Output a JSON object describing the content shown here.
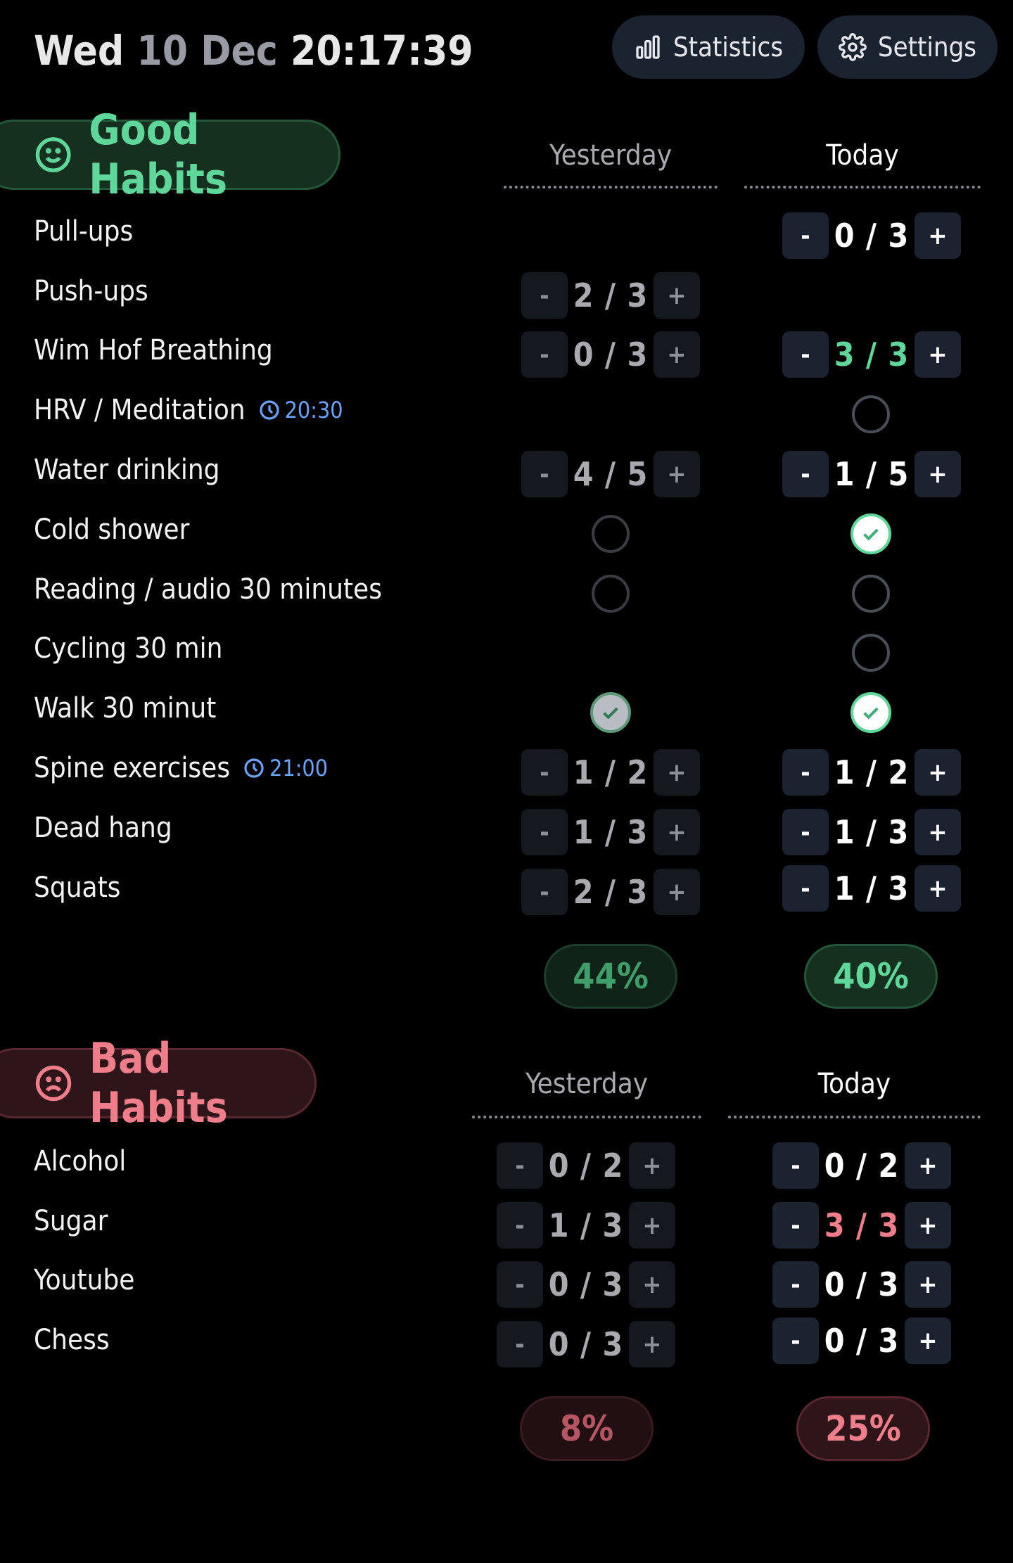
{
  "header": {
    "day": "Wed",
    "date": "10 Dec",
    "time": "20:17:39",
    "statistics_label": "Statistics",
    "settings_label": "Settings"
  },
  "good": {
    "title": "Good Habits",
    "yesterday_label": "Yesterday",
    "today_label": "Today",
    "habits": [
      {
        "name": "Pull-ups",
        "today": "0 / 3"
      },
      {
        "name": "Push-ups",
        "yesterday": "2 / 3"
      },
      {
        "name": "Wim Hof Breathing",
        "yesterday": "0 / 3",
        "today": "3 / 3"
      },
      {
        "name": "HRV / Meditation",
        "reminder": "20:30"
      },
      {
        "name": "Water drinking",
        "yesterday": "4 / 5",
        "today": "1 / 5"
      },
      {
        "name": "Cold shower"
      },
      {
        "name": "Reading / audio 30 minutes"
      },
      {
        "name": "Cycling 30 min"
      },
      {
        "name": "Walk 30 minut"
      },
      {
        "name": "Spine exercises",
        "reminder": "21:00",
        "yesterday": "1 / 2",
        "today": "1 / 2"
      },
      {
        "name": "Dead hang",
        "yesterday": "1 / 3",
        "today": "1 / 3"
      },
      {
        "name": "Squats",
        "yesterday": "2 / 3",
        "today": "1 / 3"
      }
    ],
    "yesterday_pct": "44%",
    "today_pct": "40%"
  },
  "bad": {
    "title": "Bad Habits",
    "yesterday_label": "Yesterday",
    "today_label": "Today",
    "habits": [
      {
        "name": "Alcohol",
        "yesterday": "0 / 2",
        "today": "0 / 2"
      },
      {
        "name": "Sugar",
        "yesterday": "1 / 3",
        "today": "3 / 3"
      },
      {
        "name": "Youtube",
        "yesterday": "0 / 3",
        "today": "0 / 3"
      },
      {
        "name": "Chess",
        "yesterday": "0 / 3",
        "today": "0 / 3"
      }
    ],
    "yesterday_pct": "8%",
    "today_pct": "25%"
  },
  "controls": {
    "minus": "-",
    "plus": "+"
  },
  "colors": {
    "good": "#5fd69a",
    "bad": "#f07e8a",
    "reminder": "#6aa2ff",
    "button_bg": "#1b2230"
  }
}
